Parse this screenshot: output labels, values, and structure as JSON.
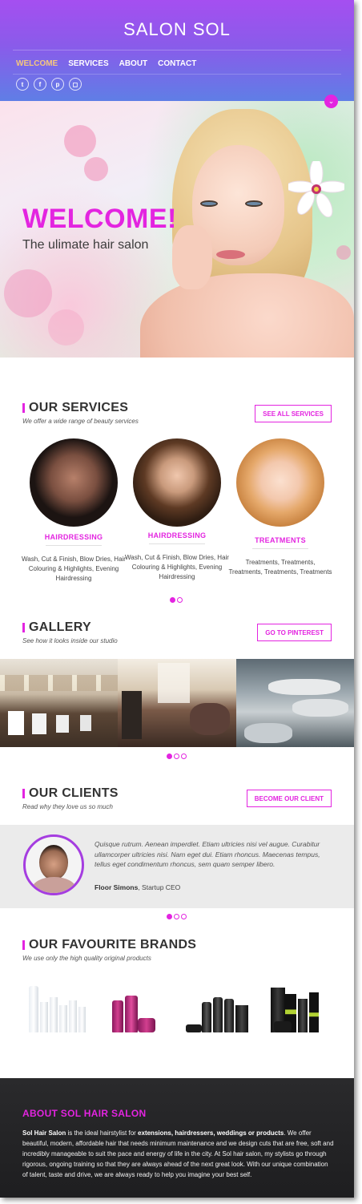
{
  "header": {
    "logo": "SALON SOL",
    "nav": [
      {
        "label": "WELCOME",
        "active": true
      },
      {
        "label": "SERVICES",
        "active": false
      },
      {
        "label": "ABOUT",
        "active": false
      },
      {
        "label": "CONTACT",
        "active": false
      }
    ],
    "social_icons": [
      "twitter-icon",
      "facebook-icon",
      "pinterest-icon",
      "instagram-icon"
    ],
    "social_glyphs": [
      "t",
      "f",
      "p",
      "◻"
    ]
  },
  "hero": {
    "title": "WELCOME!",
    "subtitle": "The ulimate hair salon"
  },
  "services": {
    "title": "OUR SERVICES",
    "subtitle": "We offer a wide range of beauty services",
    "button": "SEE ALL SERVICES",
    "items": [
      {
        "name": "HAIRDRESSING",
        "desc": "Wash, Cut & Finish, Blow Dries, Hair Colouring & Highlights, Evening Hairdressing"
      },
      {
        "name": "HAIRDRESSING",
        "desc": "Wash, Cut & Finish, Blow Dries, Hair Colouring & Highlights, Evening Hairdressing"
      },
      {
        "name": "TREATMENTS",
        "desc": "Treatments, Treatments, Treatments, Treatments, Treatments"
      }
    ]
  },
  "gallery": {
    "title": "GALLERY",
    "subtitle": "See how it looks inside our studio",
    "button": "GO TO PINTEREST"
  },
  "clients": {
    "title": "OUR CLIENTS",
    "subtitle": "Read why they love us so much",
    "button": "BECOME OUR CLIENT",
    "quote": "Quisque rutrum. Aenean imperdiet. Etiam ultricies nisi vel augue. Curabitur ullamcorper ultricies nisi. Nam eget dui. Etiam rhoncus. Maecenas tempus, tellus eget condimentum rhoncus, sem quam semper libero.",
    "author_name": "Floor Simons",
    "author_role": ", Startup CEO"
  },
  "brands": {
    "title": "OUR FAVOURITE BRANDS",
    "subtitle": "We use only the high quality original products"
  },
  "about": {
    "title": "ABOUT SOL HAIR SALON",
    "brand": "Sol Hair Salon",
    "text_1": " is the ideal hairstylist for ",
    "highlight": "extensions, hairdressers, weddings or products",
    "text_2": ". We offer beautiful, modern, affordable hair that needs minimum maintenance and we design cuts that are free, soft and incredibly manageable to suit the pace and energy of life in the city. At Sol hair salon, my stylists go through rigorous, ongoing training so that they are always ahead of the next great look. With our unique combination of talent, taste and drive, we are always ready to help you imagine your best self."
  },
  "colors": {
    "accent": "#e324e0",
    "header_top": "#a54ff0",
    "header_bottom": "#5f7ee6",
    "nav_active": "#f4c77d"
  }
}
